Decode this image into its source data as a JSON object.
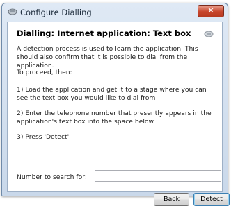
{
  "window": {
    "title": "Configure Dialling",
    "close_glyph": "✕"
  },
  "content": {
    "heading": "Dialling: Internet application: Text box",
    "intro": "A detection process is used to learn the application. This should also confirm that it is possible to dial from the application.",
    "proceed": "To proceed, then:",
    "step1": "1) Load the application and get it to a stage where you can see the text box you would like to dial from",
    "step2": "2) Enter the telephone number that presently appears in the application's text box into the space below",
    "step3": "3) Press 'Detect'",
    "search_label": "Number to search for:",
    "search_value": ""
  },
  "buttons": {
    "back": "Back",
    "detect": "Detect"
  },
  "icons": {
    "title": "phone-icon",
    "heading": "phone-icon"
  }
}
